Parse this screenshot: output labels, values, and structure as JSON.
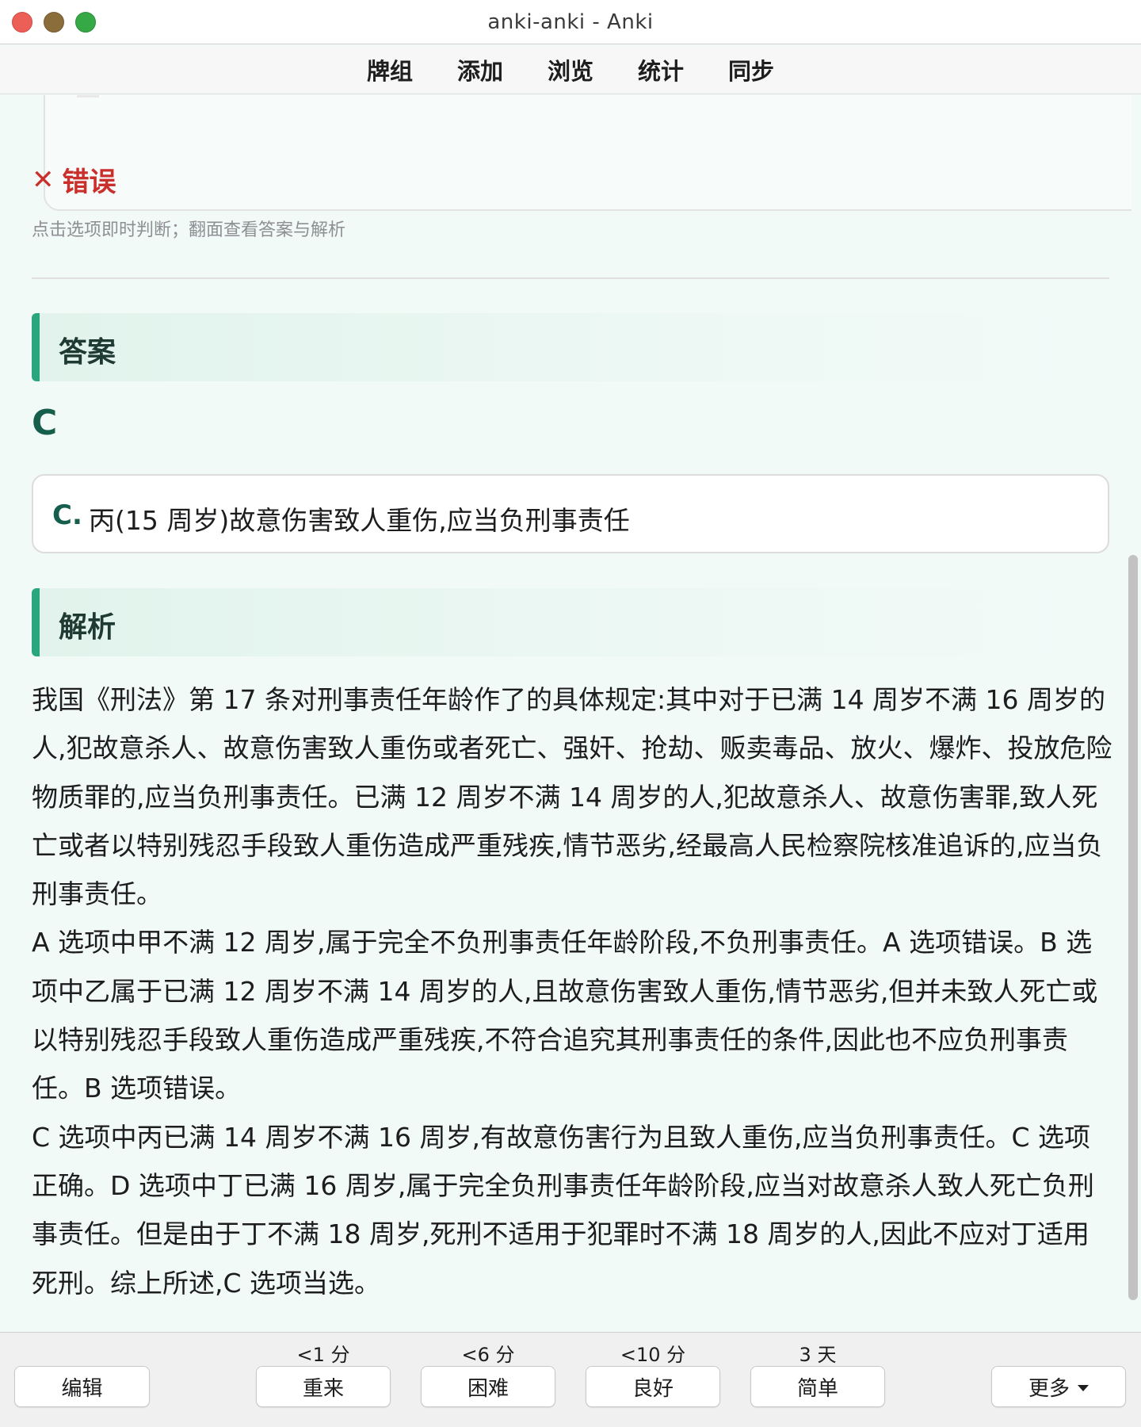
{
  "window": {
    "title": "anki-anki - Anki"
  },
  "menu": {
    "items": [
      "牌组",
      "添加",
      "浏览",
      "统计",
      "同步"
    ]
  },
  "card": {
    "result_icon": "✕",
    "result_label": "错误",
    "hint": "点击选项即时判断；翻面查看答案与解析",
    "answer_heading": "答案",
    "answer_letter": "C",
    "answer_option": {
      "label": "C.",
      "text": "丙(15 周岁)故意伤害致人重伤,应当负刑事责任"
    },
    "analysis_heading": "解析",
    "analysis_paragraphs": [
      "我国《刑法》第 17 条对刑事责任年龄作了的具体规定:其中对于已满 14 周岁不满 16 周岁的人,犯故意杀人、故意伤害致人重伤或者死亡、强奸、抢劫、贩卖毒品、放火、爆炸、投放危险物质罪的,应当负刑事责任。已满 12 周岁不满 14 周岁的人,犯故意杀人、故意伤害罪,致人死亡或者以特别残忍手段致人重伤造成严重残疾,情节恶劣,经最高人民检察院核准追诉的,应当负刑事责任。",
      "A 选项中甲不满 12 周岁,属于完全不负刑事责任年龄阶段,不负刑事责任。A 选项错误。B 选项中乙属于已满 12 周岁不满 14 周岁的人,且故意伤害致人重伤,情节恶劣,但并未致人死亡或以特别残忍手段致人重伤造成严重残疾,不符合追究其刑事责任的条件,因此也不应负刑事责任。B 选项错误。",
      "C 选项中丙已满 14 周岁不满 16 周岁,有故意伤害行为且致人重伤,应当负刑事责任。C 选项正确。D 选项中丁已满 16 周岁,属于完全负刑事责任年龄阶段,应当对故意杀人致人死亡负刑事责任。但是由于丁不满 18 周岁,死刑不适用于犯罪时不满 18 周岁的人,因此不应对丁适用死刑。综上所述,C 选项当选。"
    ]
  },
  "bottom": {
    "edit": "编辑",
    "more": "更多",
    "answers": [
      {
        "interval": "<1 分",
        "label": "重来"
      },
      {
        "interval": "<6 分",
        "label": "困难"
      },
      {
        "interval": "<10 分",
        "label": "良好"
      },
      {
        "interval": "3 天",
        "label": "简单"
      }
    ]
  },
  "colors": {
    "wrong": "#c9302c",
    "accent_green": "#2aa67f",
    "answer_green": "#155e4b",
    "card_bg": "#f2faf8"
  }
}
